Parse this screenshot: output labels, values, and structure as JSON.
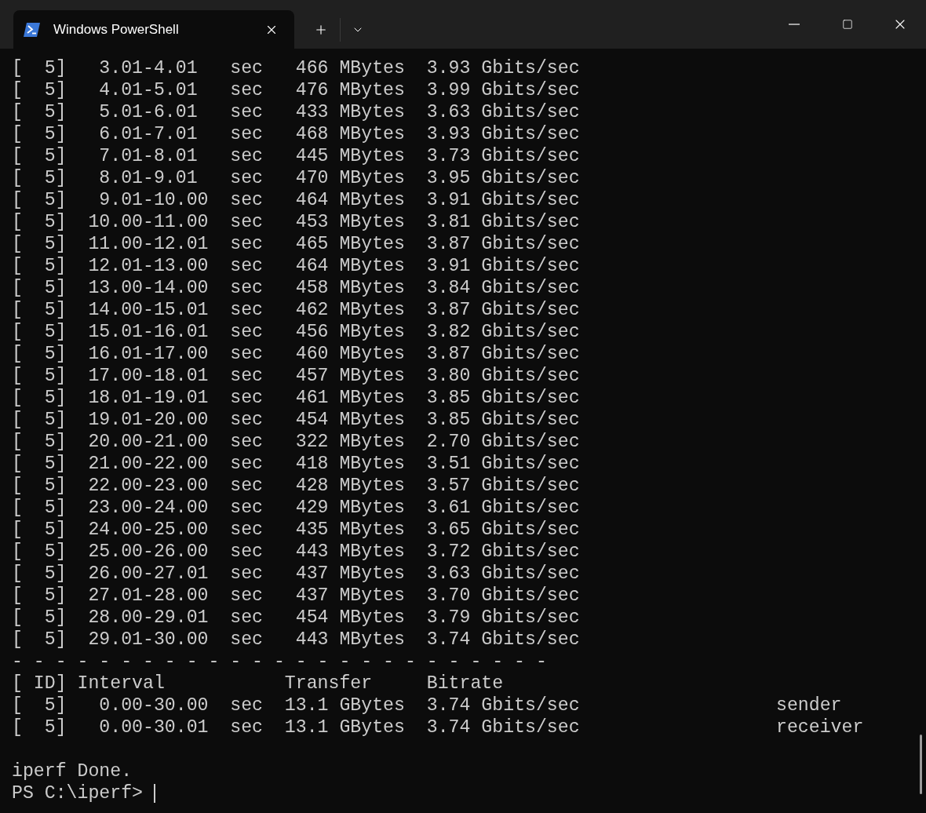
{
  "tabs": [
    {
      "title": "Windows PowerShell",
      "selected": true
    }
  ],
  "lines": [
    "[  5]   3.01-4.01   sec   466 MBytes  3.93 Gbits/sec",
    "[  5]   4.01-5.01   sec   476 MBytes  3.99 Gbits/sec",
    "[  5]   5.01-6.01   sec   433 MBytes  3.63 Gbits/sec",
    "[  5]   6.01-7.01   sec   468 MBytes  3.93 Gbits/sec",
    "[  5]   7.01-8.01   sec   445 MBytes  3.73 Gbits/sec",
    "[  5]   8.01-9.01   sec   470 MBytes  3.95 Gbits/sec",
    "[  5]   9.01-10.00  sec   464 MBytes  3.91 Gbits/sec",
    "[  5]  10.00-11.00  sec   453 MBytes  3.81 Gbits/sec",
    "[  5]  11.00-12.01  sec   465 MBytes  3.87 Gbits/sec",
    "[  5]  12.01-13.00  sec   464 MBytes  3.91 Gbits/sec",
    "[  5]  13.00-14.00  sec   458 MBytes  3.84 Gbits/sec",
    "[  5]  14.00-15.01  sec   462 MBytes  3.87 Gbits/sec",
    "[  5]  15.01-16.01  sec   456 MBytes  3.82 Gbits/sec",
    "[  5]  16.01-17.00  sec   460 MBytes  3.87 Gbits/sec",
    "[  5]  17.00-18.01  sec   457 MBytes  3.80 Gbits/sec",
    "[  5]  18.01-19.01  sec   461 MBytes  3.85 Gbits/sec",
    "[  5]  19.01-20.00  sec   454 MBytes  3.85 Gbits/sec",
    "[  5]  20.00-21.00  sec   322 MBytes  2.70 Gbits/sec",
    "[  5]  21.00-22.00  sec   418 MBytes  3.51 Gbits/sec",
    "[  5]  22.00-23.00  sec   428 MBytes  3.57 Gbits/sec",
    "[  5]  23.00-24.00  sec   429 MBytes  3.61 Gbits/sec",
    "[  5]  24.00-25.00  sec   435 MBytes  3.65 Gbits/sec",
    "[  5]  25.00-26.00  sec   443 MBytes  3.72 Gbits/sec",
    "[  5]  26.00-27.01  sec   437 MBytes  3.63 Gbits/sec",
    "[  5]  27.01-28.00  sec   437 MBytes  3.70 Gbits/sec",
    "[  5]  28.00-29.01  sec   454 MBytes  3.79 Gbits/sec",
    "[  5]  29.01-30.00  sec   443 MBytes  3.74 Gbits/sec",
    "- - - - - - - - - - - - - - - - - - - - - - - - -",
    "[ ID] Interval           Transfer     Bitrate",
    "[  5]   0.00-30.00  sec  13.1 GBytes  3.74 Gbits/sec                  sender",
    "[  5]   0.00-30.01  sec  13.1 GBytes  3.74 Gbits/sec                  receiver"
  ],
  "status_line": "iperf Done.",
  "prompt": "PS C:\\iperf>"
}
